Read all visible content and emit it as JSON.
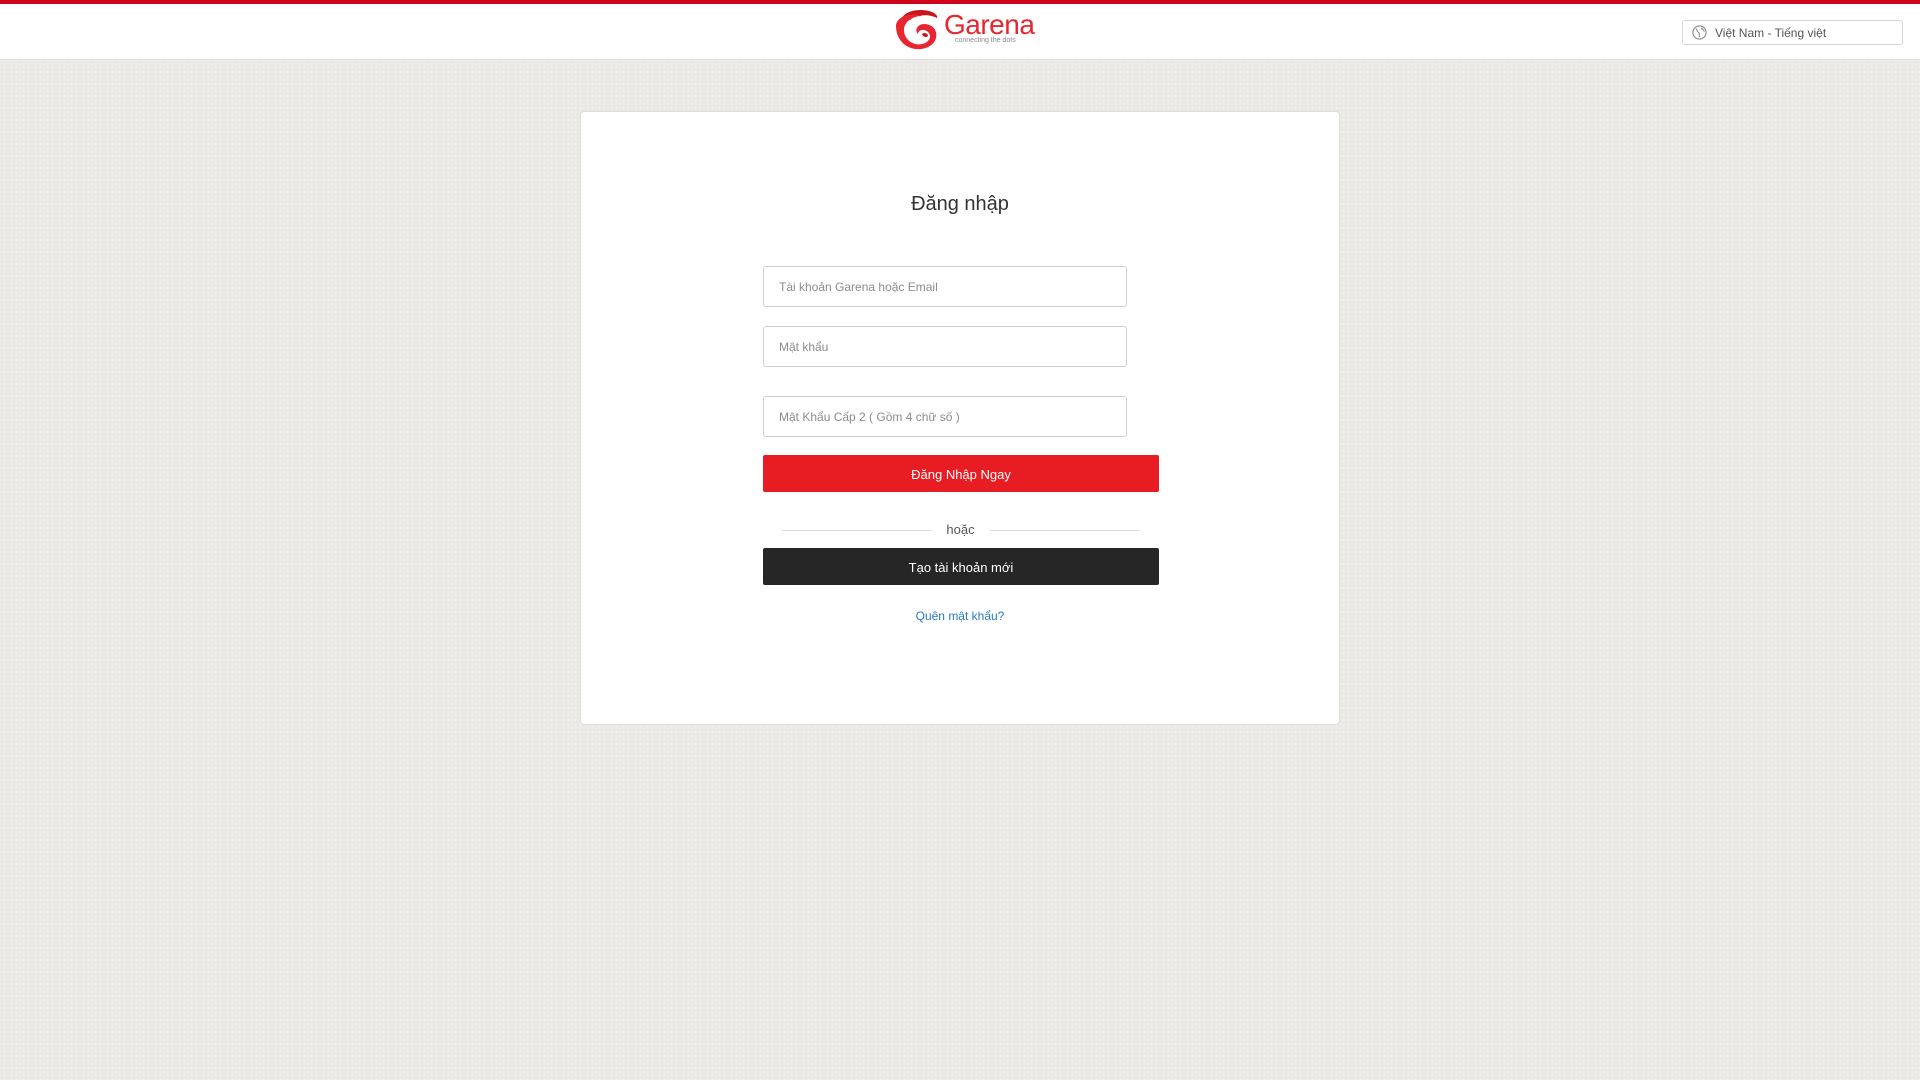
{
  "header": {
    "logo": {
      "brand": "Garena",
      "tagline": "connecting the dots"
    },
    "language_selector": {
      "label": "Việt Nam - Tiếng việt",
      "icon": "globe-icon"
    }
  },
  "login_form": {
    "title": "Đăng nhập",
    "account_field": {
      "placeholder": "Tài khoản Garena hoặc Email",
      "value": ""
    },
    "password_field": {
      "placeholder": "Mật khẩu",
      "value": ""
    },
    "secondary_password_field": {
      "placeholder": "Mật Khẩu Cấp 2 ( Gồm 4 chữ số )",
      "value": ""
    },
    "login_button": "Đăng Nhập Ngay",
    "divider_text": "hoặc",
    "register_button": "Tạo tài khoản mới",
    "forgot_password_link": "Quên mật khẩu?"
  },
  "colors": {
    "accent_red": "#e81c23",
    "top_stripe": "#d0021b",
    "dark_button": "#262626",
    "link_blue": "#2a7ac0",
    "page_background": "#ecebe7"
  }
}
